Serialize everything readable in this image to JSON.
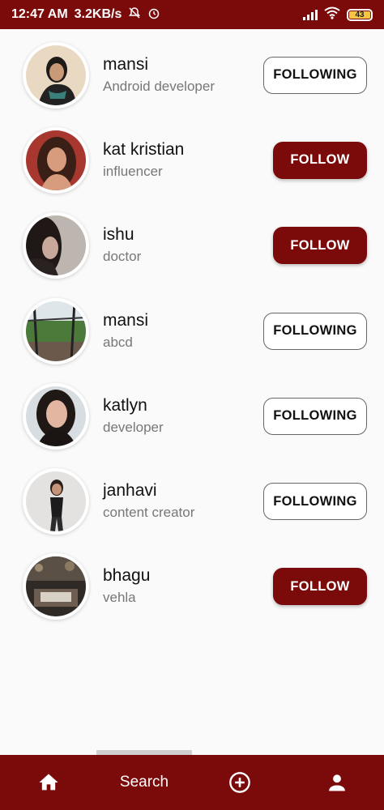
{
  "status_bar": {
    "time": "12:47 AM",
    "speed": "3.2KB/s",
    "icons": [
      "mute-bell-icon",
      "alarm-icon",
      "signal-icon",
      "wifi-icon"
    ],
    "battery": "43"
  },
  "colors": {
    "primary": "#7b0b0b",
    "background": "#fafafa",
    "subtitle": "#777777"
  },
  "users": [
    {
      "name": "mansi",
      "subtitle": "Android developer",
      "button": "FOLLOWING",
      "state": "following"
    },
    {
      "name": "kat kristian",
      "subtitle": "influencer",
      "button": "FOLLOW",
      "state": "follow"
    },
    {
      "name": "ishu",
      "subtitle": "doctor",
      "button": "FOLLOW",
      "state": "follow"
    },
    {
      "name": "mansi",
      "subtitle": "abcd",
      "button": "FOLLOWING",
      "state": "following"
    },
    {
      "name": "katlyn",
      "subtitle": "developer",
      "button": "FOLLOWING",
      "state": "following"
    },
    {
      "name": "janhavi",
      "subtitle": "content creator",
      "button": "FOLLOWING",
      "state": "following"
    },
    {
      "name": "bhagu",
      "subtitle": "vehla",
      "button": "FOLLOW",
      "state": "follow"
    }
  ],
  "bottom_nav": {
    "items": [
      {
        "icon": "home-icon"
      },
      {
        "label": "Search"
      },
      {
        "icon": "add-circle-icon"
      },
      {
        "icon": "person-icon"
      }
    ]
  }
}
